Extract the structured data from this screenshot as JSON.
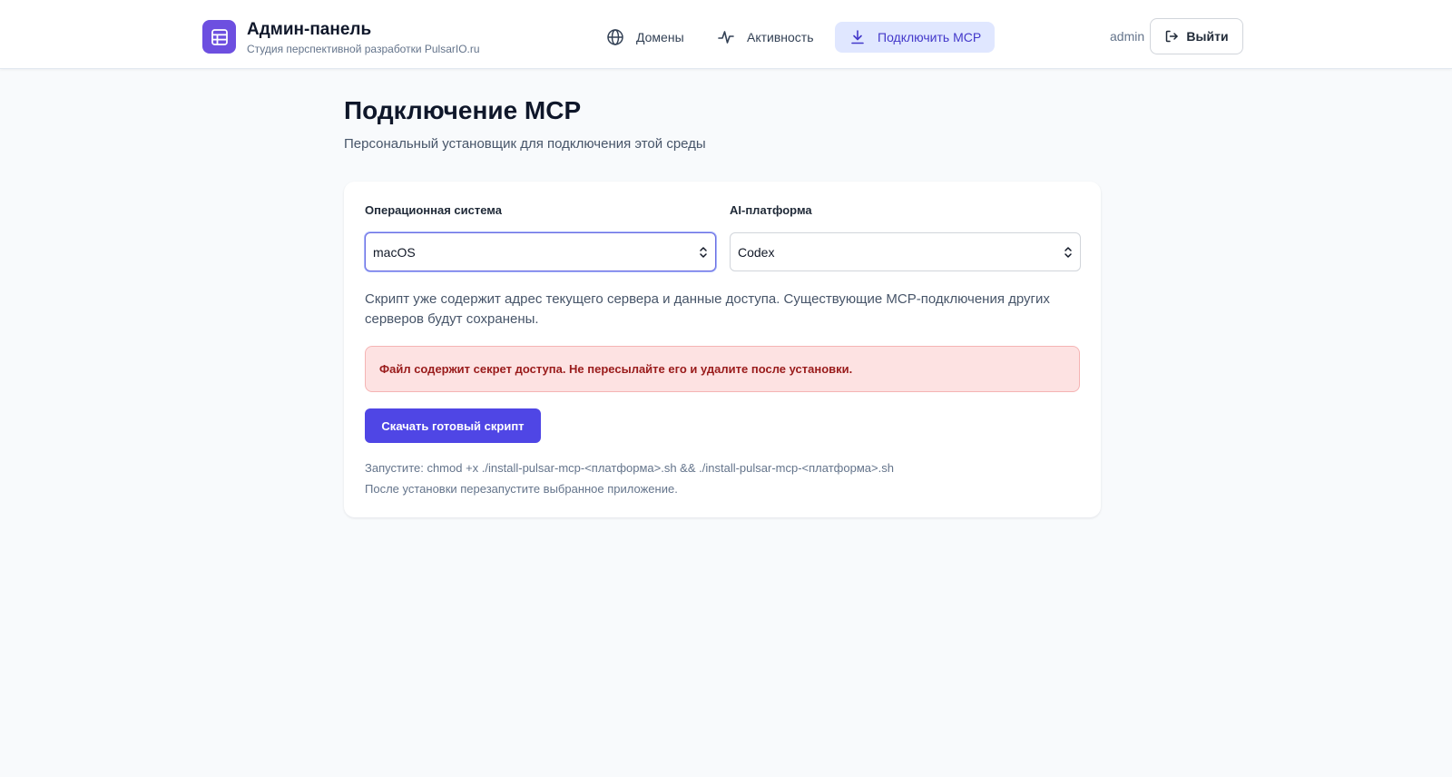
{
  "colors": {
    "accent": "#4f46e5",
    "logo": "#6d4fe0",
    "nav_active_bg": "#e0e7ff",
    "alert_bg": "#fde2e2",
    "alert_text": "#991b1b",
    "page_bg": "#f8fafc"
  },
  "header": {
    "title": "Админ-панель",
    "subtitle": "Студия перспективной разработки PulsarIO.ru",
    "logo_icon": "table-icon",
    "nav": [
      {
        "label": "Домены",
        "icon": "globe-icon",
        "active": false
      },
      {
        "label": "Активность",
        "icon": "activity-icon",
        "active": false
      },
      {
        "label": "Подключить MCP",
        "icon": "download-icon",
        "active": true
      }
    ],
    "user": "admin",
    "logout_label": "Выйти",
    "logout_icon": "logout-icon"
  },
  "main": {
    "title": "Подключение MCP",
    "subtitle": "Персональный установщик для подключения этой среды",
    "form": {
      "os_label": "Операционная система",
      "os_value": "macOS",
      "platform_label": "AI-платформа",
      "platform_value": "Codex"
    },
    "description": "Скрипт уже содержит адрес текущего сервера и данные доступа. Существующие MCP-подключения других серверов будут сохранены.",
    "alert": "Файл содержит секрет доступа. Не пересылайте его и удалите после установки.",
    "download_label": "Скачать готовый скрипт",
    "hint_command": "Запустите: chmod +x ./install-pulsar-mcp-<платформа>.sh && ./install-pulsar-mcp-<платформа>.sh",
    "hint_restart": "После установки перезапустите выбранное приложение."
  }
}
